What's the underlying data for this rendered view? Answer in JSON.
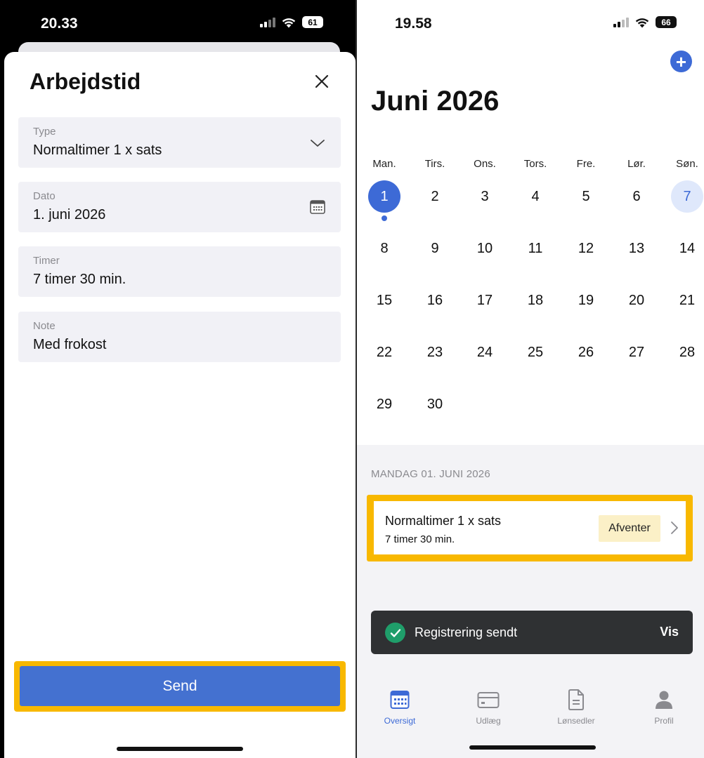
{
  "left": {
    "status": {
      "time": "20.33",
      "battery": "61"
    },
    "sheet": {
      "title": "Arbejdstid",
      "fields": {
        "type": {
          "label": "Type",
          "value": "Normaltimer 1 x sats"
        },
        "date": {
          "label": "Dato",
          "value": "1. juni 2026"
        },
        "hours": {
          "label": "Timer",
          "value": "7 timer 30 min."
        },
        "note": {
          "label": "Note",
          "value": "Med frokost"
        }
      },
      "send_label": "Send"
    }
  },
  "right": {
    "status": {
      "time": "19.58",
      "battery": "66"
    },
    "plus_label": "+",
    "month_title": "Juni 2026",
    "weekdays": [
      "Man.",
      "Tirs.",
      "Ons.",
      "Tors.",
      "Fre.",
      "Lør.",
      "Søn."
    ],
    "weeks": [
      [
        "1",
        "2",
        "3",
        "4",
        "5",
        "6",
        "7"
      ],
      [
        "8",
        "9",
        "10",
        "11",
        "12",
        "13",
        "14"
      ],
      [
        "15",
        "16",
        "17",
        "18",
        "19",
        "20",
        "21"
      ],
      [
        "22",
        "23",
        "24",
        "25",
        "26",
        "27",
        "28"
      ],
      [
        "29",
        "30",
        "",
        "",
        "",
        "",
        ""
      ]
    ],
    "selected_day_label": "MANDAG 01. JUNI 2026",
    "entry": {
      "title": "Normaltimer 1 x sats",
      "subtitle": "7 timer 30 min.",
      "status": "Afventer"
    },
    "toast": {
      "message": "Registrering sendt",
      "action": "Vis"
    },
    "tabs": [
      {
        "label": "Oversigt",
        "icon": "calendar-icon"
      },
      {
        "label": "Udlæg",
        "icon": "credit-card-icon"
      },
      {
        "label": "Lønsedler",
        "icon": "document-icon"
      },
      {
        "label": "Profil",
        "icon": "person-icon"
      }
    ]
  },
  "colors": {
    "accent": "#3d6ad6",
    "send_button": "#4471d0",
    "highlight": "#f8b800",
    "field_bg": "#f1f1f6",
    "badge_bg": "#fbf0c7",
    "toast_bg": "#2f3133",
    "success": "#1f9e6a"
  }
}
